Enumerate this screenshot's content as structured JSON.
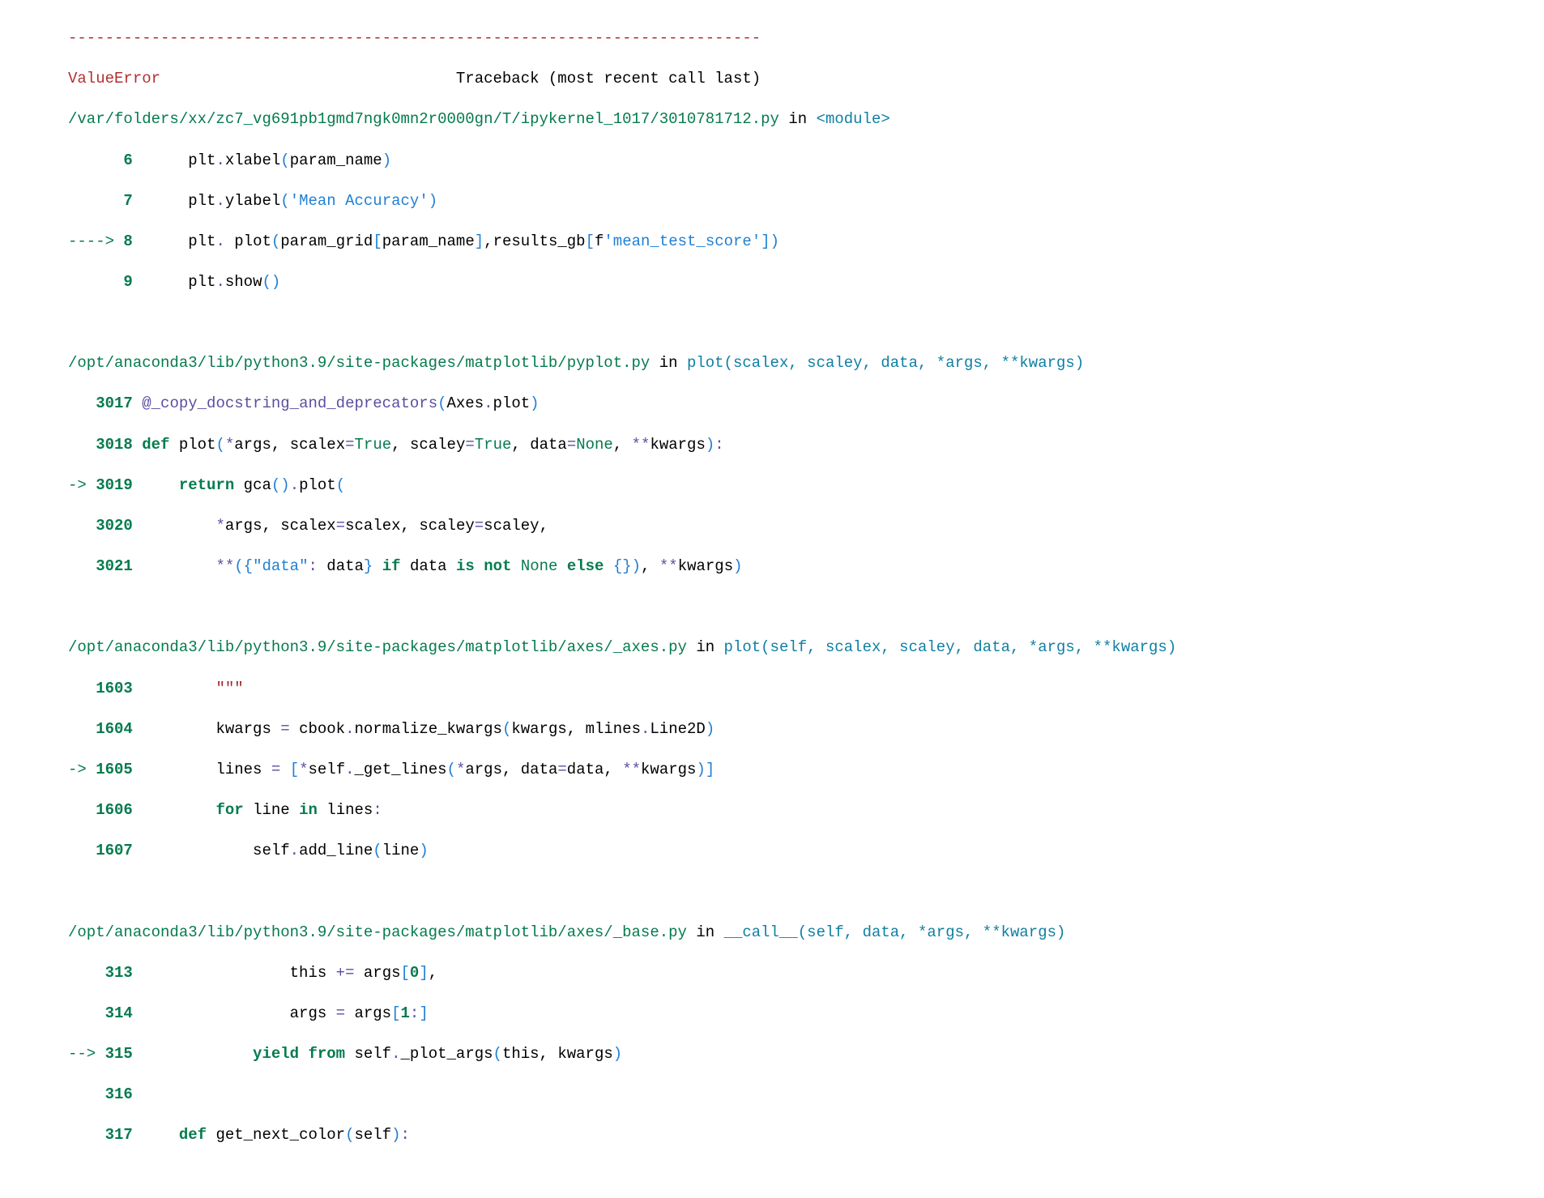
{
  "sep": "---------------------------------------------------------------------------",
  "header": {
    "error": "ValueError",
    "gap": "                                ",
    "tb": "Traceback (most recent call last)"
  },
  "f0": {
    "path": "/var/folders/xx/zc7_vg691pb1gmd7ngk0mn2r0000gn/T/ipykernel_1017/3010781712.py",
    "in": " in ",
    "func": "<module>",
    "l6": {
      "arrow": "      ",
      "num": "6 ",
      "code": {
        "a": "     plt",
        "b": ".",
        "c": "xlabel",
        "d": "(",
        "e": "param_name",
        "f": ")"
      }
    },
    "l7": {
      "arrow": "      ",
      "num": "7 ",
      "code": {
        "a": "     plt",
        "b": ".",
        "c": "ylabel",
        "d": "(",
        "e": "'Mean Accuracy'",
        "f": ")"
      }
    },
    "l8": {
      "arrow": "----> ",
      "num": "8 ",
      "code": {
        "a": "     plt",
        "b": ".",
        "c": " plot",
        "d": "(",
        "e": "param_grid",
        "f": "[",
        "g": "param_name",
        "h": "]",
        "i": ",",
        "j": "results_gb",
        "k": "[",
        "l": "f",
        "m": "'mean_test_score'",
        "n": "]",
        "o": ")"
      }
    },
    "l9": {
      "arrow": "      ",
      "num": "9 ",
      "code": {
        "a": "     plt",
        "b": ".",
        "c": "show",
        "d": "(",
        "e": ")"
      }
    }
  },
  "f1": {
    "path": "/opt/anaconda3/lib/python3.9/site-packages/matplotlib/pyplot.py",
    "in": " in ",
    "func": "plot",
    "sig": "(scalex, scaley, data, *args, **kwargs)",
    "l3017": {
      "arrow": "   ",
      "num": "3017 ",
      "code": {
        "a": "@_copy_docstring_and_deprecators",
        "b": "(",
        "c": "Axes",
        "d": ".",
        "e": "plot",
        "f": ")"
      }
    },
    "l3018": {
      "arrow": "   ",
      "num": "3018 ",
      "code": {
        "a": "def",
        "b": " plot",
        "c": "(",
        "d": "*",
        "e": "args",
        "f": ",",
        "g": " scalex",
        "h": "=",
        "i": "True",
        "j": ",",
        "k": " scaley",
        "l": "=",
        "m": "True",
        "n": ",",
        "o": " data",
        "p": "=",
        "q": "None",
        "r": ",",
        "s": " ",
        "t": "**",
        "u": "kwargs",
        "v": ")",
        "w": ":"
      }
    },
    "l3019": {
      "arrow": "-> ",
      "num": "3019 ",
      "code": {
        "a": "    ",
        "b": "return",
        "c": " gca",
        "d": "(",
        "e": ")",
        "f": ".",
        "g": "plot",
        "h": "("
      }
    },
    "l3020": {
      "arrow": "   ",
      "num": "3020 ",
      "code": {
        "a": "        ",
        "b": "*",
        "c": "args",
        "d": ",",
        "e": " scalex",
        "f": "=",
        "g": "scalex",
        "h": ",",
        "i": " scaley",
        "j": "=",
        "k": "scaley",
        "l": ","
      }
    },
    "l3021": {
      "arrow": "   ",
      "num": "3021 ",
      "code": {
        "a": "        ",
        "b": "**",
        "c": "(",
        "d": "{",
        "e": "\"data\"",
        "f": ":",
        "g": " data",
        "h": "}",
        "i": " ",
        "j": "if",
        "k": " data ",
        "l": "is",
        "m": " ",
        "n": "not",
        "o": " ",
        "p": "None",
        "q": " ",
        "r": "else",
        "s": " ",
        "t": "{",
        "u": "}",
        "v": ")",
        "w": ",",
        "x": " ",
        "y": "**",
        "z": "kwargs",
        "aa": ")"
      }
    }
  },
  "f2": {
    "path": "/opt/anaconda3/lib/python3.9/site-packages/matplotlib/axes/_axes.py",
    "in": " in ",
    "func": "plot",
    "sig": "(self, scalex, scaley, data, *args, **kwargs)",
    "l1603": {
      "arrow": "   ",
      "num": "1603 ",
      "code": {
        "a": "        ",
        "b": "\"\"\""
      }
    },
    "l1604": {
      "arrow": "   ",
      "num": "1604 ",
      "code": {
        "a": "        kwargs ",
        "b": "=",
        "c": " cbook",
        "d": ".",
        "e": "normalize_kwargs",
        "f": "(",
        "g": "kwargs",
        "h": ",",
        "i": " mlines",
        "j": ".",
        "k": "Line2D",
        "l": ")"
      }
    },
    "l1605": {
      "arrow": "-> ",
      "num": "1605 ",
      "code": {
        "a": "        lines ",
        "b": "=",
        "c": " ",
        "d": "[",
        "e": "*",
        "f": "self",
        "g": ".",
        "h": "_get_lines",
        "i": "(",
        "j": "*",
        "k": "args",
        "l": ",",
        "m": " data",
        "n": "=",
        "o": "data",
        "p": ",",
        "q": " ",
        "r": "**",
        "s": "kwargs",
        "t": ")",
        "u": "]"
      }
    },
    "l1606": {
      "arrow": "   ",
      "num": "1606 ",
      "code": {
        "a": "        ",
        "b": "for",
        "c": " line ",
        "d": "in",
        "e": " lines",
        "f": ":"
      }
    },
    "l1607": {
      "arrow": "   ",
      "num": "1607 ",
      "code": {
        "a": "            self",
        "b": ".",
        "c": "add_line",
        "d": "(",
        "e": "line",
        "f": ")"
      }
    }
  },
  "f3": {
    "path": "/opt/anaconda3/lib/python3.9/site-packages/matplotlib/axes/_base.py",
    "in": " in ",
    "func": "__call__",
    "sig": "(self, data, *args, **kwargs)",
    "l313": {
      "arrow": "    ",
      "num": "313 ",
      "code": {
        "a": "                this ",
        "b": "+=",
        "c": " args",
        "d": "[",
        "e": "0",
        "f": "]",
        "g": ","
      }
    },
    "l314": {
      "arrow": "    ",
      "num": "314 ",
      "code": {
        "a": "                args ",
        "b": "=",
        "c": " args",
        "d": "[",
        "e": "1",
        "f": ":",
        "g": "]"
      }
    },
    "l315": {
      "arrow": "--> ",
      "num": "315 ",
      "code": {
        "a": "            ",
        "b": "yield",
        "c": " ",
        "d": "from",
        "e": " self",
        "f": ".",
        "g": "_plot_args",
        "h": "(",
        "i": "this",
        "j": ",",
        "k": " kwargs",
        "l": ")"
      }
    },
    "l316": {
      "arrow": "    ",
      "num": "316 ",
      "code": {
        "a": ""
      }
    },
    "l317": {
      "arrow": "    ",
      "num": "317 ",
      "code": {
        "a": "    ",
        "b": "def",
        "c": " get_next_color",
        "d": "(",
        "e": "self",
        "f": ")",
        "g": ":"
      }
    }
  }
}
